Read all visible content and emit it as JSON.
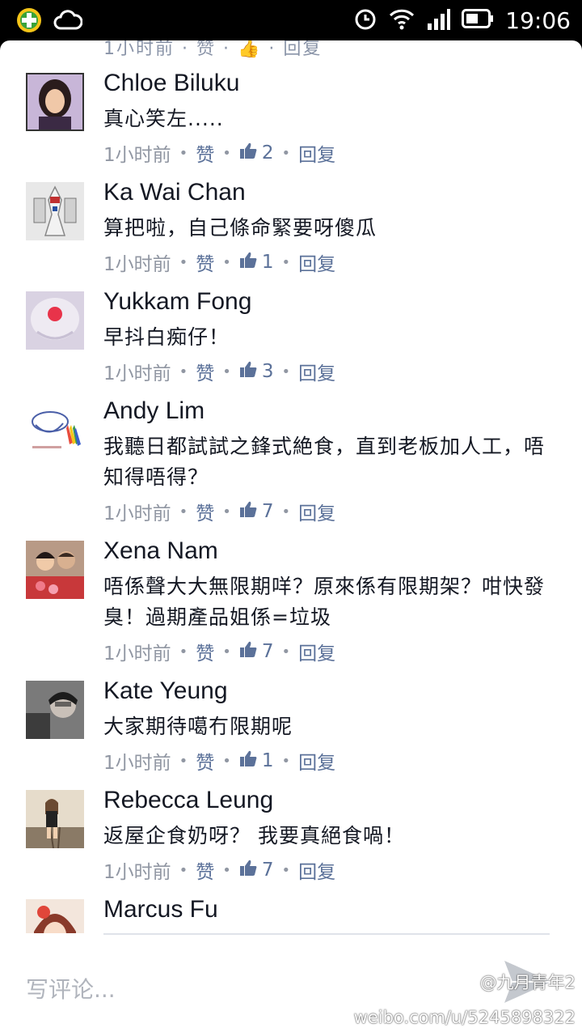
{
  "status_bar": {
    "time": "19:06",
    "icons": [
      "app-plus-icon",
      "cloud-icon",
      "alarm-icon",
      "wifi-icon",
      "signal-icon",
      "battery-icon"
    ]
  },
  "top_cut_text": "1小时前 · 赞 · 👍 · 回复",
  "comments": [
    {
      "name": "Chloe Biluku",
      "text": "真心笑左.....",
      "time": "1小时前",
      "like_label": "赞",
      "likes": "2",
      "reply_label": "回复"
    },
    {
      "name": "Ka Wai Chan",
      "text": "算把啦，自己條命緊要呀傻瓜",
      "time": "1小时前",
      "like_label": "赞",
      "likes": "1",
      "reply_label": "回复"
    },
    {
      "name": "Yukkam Fong",
      "text": "早抖白痴仔！",
      "time": "1小时前",
      "like_label": "赞",
      "likes": "3",
      "reply_label": "回复"
    },
    {
      "name": "Andy Lim",
      "text": "我聽日都試試之鋒式絶食，直到老板加人工，唔知得唔得？",
      "time": "1小时前",
      "like_label": "赞",
      "likes": "7",
      "reply_label": "回复"
    },
    {
      "name": "Xena Nam",
      "text": "唔係聲大大無限期咩？原來係有限期架？咁快發臭！過期產品姐係=垃圾",
      "time": "1小时前",
      "like_label": "赞",
      "likes": "7",
      "reply_label": "回复"
    },
    {
      "name": "Kate Yeung",
      "text": "大家期待噶冇限期呢",
      "time": "1小时前",
      "like_label": "赞",
      "likes": "1",
      "reply_label": "回复"
    },
    {
      "name": "Rebecca Leung",
      "text": "返屋企食奶呀？ 我要真絕食喎！",
      "time": "1小时前",
      "like_label": "赞",
      "likes": "7",
      "reply_label": "回复"
    },
    {
      "name": "Marcus Fu",
      "text": "",
      "time": "",
      "like_label": "",
      "likes": "",
      "reply_label": ""
    }
  ],
  "composer": {
    "placeholder": "写评论..."
  },
  "watermark": {
    "handle": "@九月青年2",
    "url": "weibo.com/u/5245898322"
  },
  "colors": {
    "accent": "#5b7199",
    "muted": "#9197a3",
    "text": "#141823"
  }
}
